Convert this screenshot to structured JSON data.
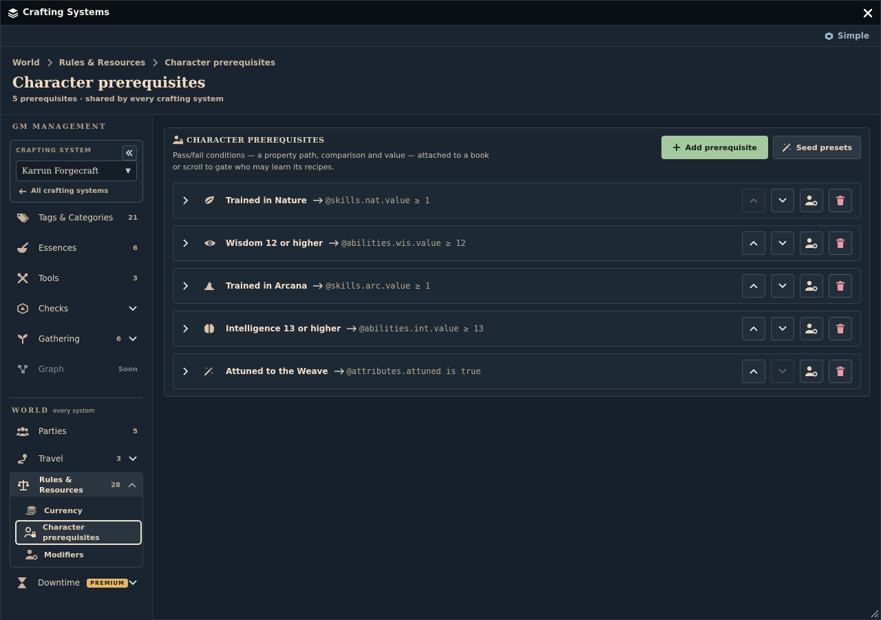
{
  "window": {
    "title": "Crafting Systems"
  },
  "mode": {
    "label": "Simple"
  },
  "breadcrumb": [
    "World",
    "Rules & Resources",
    "Character prerequisites"
  ],
  "page": {
    "title": "Character prerequisites",
    "subtitle": "5 prerequisites · shared by every crafting system"
  },
  "sidebar": {
    "gm_label": "GM MANAGEMENT",
    "system_label": "CRAFTING SYSTEM",
    "system_value": "Karrun Forgecraft",
    "all_link": "All crafting systems",
    "gm_items": [
      {
        "label": "Tags & Categories",
        "count": "21",
        "icon": "tags-icon"
      },
      {
        "label": "Essences",
        "count": "6",
        "icon": "mortar-icon"
      },
      {
        "label": "Tools",
        "count": "3",
        "icon": "tools-icon"
      },
      {
        "label": "Checks",
        "count": "",
        "icon": "dice-icon"
      },
      {
        "label": "Gathering",
        "count": "6",
        "icon": "seedling-icon"
      },
      {
        "label": "Graph",
        "count": "Soon",
        "icon": "graph-icon"
      }
    ],
    "world_label": "WORLD",
    "world_sub": "every system",
    "world_items": [
      {
        "label": "Parties",
        "count": "5",
        "icon": "users-icon"
      },
      {
        "label": "Travel",
        "count": "3",
        "icon": "route-icon"
      }
    ],
    "rules": {
      "label": "Rules & Resources",
      "count": "28",
      "children": [
        {
          "label": "Currency",
          "icon": "coins-icon"
        },
        {
          "label": "Character prerequisites",
          "icon": "user-lock-icon"
        },
        {
          "label": "Modifiers",
          "icon": "user-gear-icon"
        }
      ]
    },
    "downtime": {
      "label": "Downtime",
      "badge": "PREMIUM"
    }
  },
  "panel": {
    "title": "CHARACTER PREREQUISITES",
    "description": "Pass/fail conditions — a property path, comparison and value — attached to a book or scroll to gate who may learn its recipes.",
    "add_label": "Add prerequisite",
    "seed_label": "Seed presets"
  },
  "prerequisites": [
    {
      "name": "Trained in Nature",
      "expr": "@skills.nat.value ≥ 1",
      "icon": "leaf-icon"
    },
    {
      "name": "Wisdom 12 or higher",
      "expr": "@abilities.wis.value ≥ 12",
      "icon": "eye-icon"
    },
    {
      "name": "Trained in Arcana",
      "expr": "@skills.arc.value ≥ 1",
      "icon": "wizard-hat-icon"
    },
    {
      "name": "Intelligence 13 or higher",
      "expr": "@abilities.int.value ≥ 13",
      "icon": "brain-icon"
    },
    {
      "name": "Attuned to the Weave",
      "expr": "@attributes.attuned is true",
      "icon": "magic-wand-icon"
    }
  ],
  "colors": {
    "accent_green": "#a4c99e",
    "danger_pink": "#e79aa4",
    "premium_gold": "#e3b76a"
  }
}
